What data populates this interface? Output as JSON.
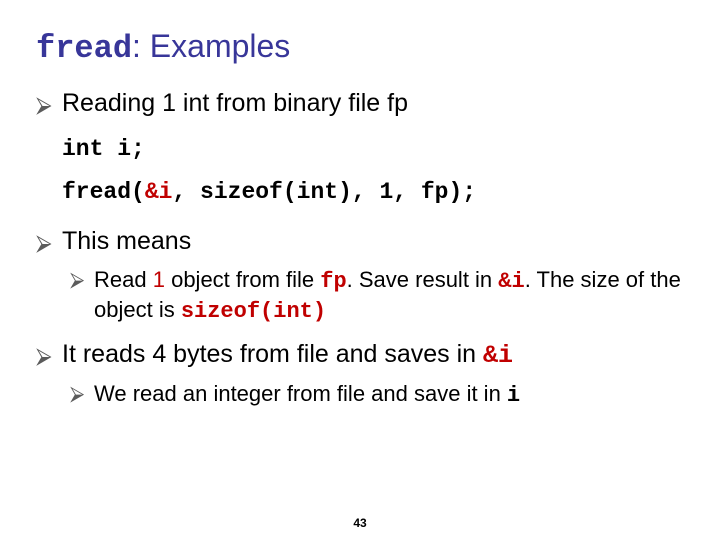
{
  "title": {
    "mono": "fread",
    "rest": ": Examples"
  },
  "bullet_glyph": "⮚",
  "b1": {
    "text": "Reading 1 int from binary file fp"
  },
  "code": {
    "line1": "int i;",
    "line2a": "fread(",
    "line2b": "&i",
    "line2c": ", sizeof(int), 1, fp);"
  },
  "b2": {
    "text": "This means"
  },
  "b2a": {
    "p1": "Read ",
    "one": "1",
    "p2": " object from file ",
    "fp": "fp",
    "p3": ". Save result in ",
    "amp_i": "&i",
    "p4": ". The size of the object is ",
    "sizeof": "sizeof(int)"
  },
  "b3": {
    "p1": "It reads 4 bytes from file and saves in ",
    "amp_i": "&i"
  },
  "b3a": {
    "p1": "We read an integer from file and save it in ",
    "i": "i"
  },
  "page": "43"
}
